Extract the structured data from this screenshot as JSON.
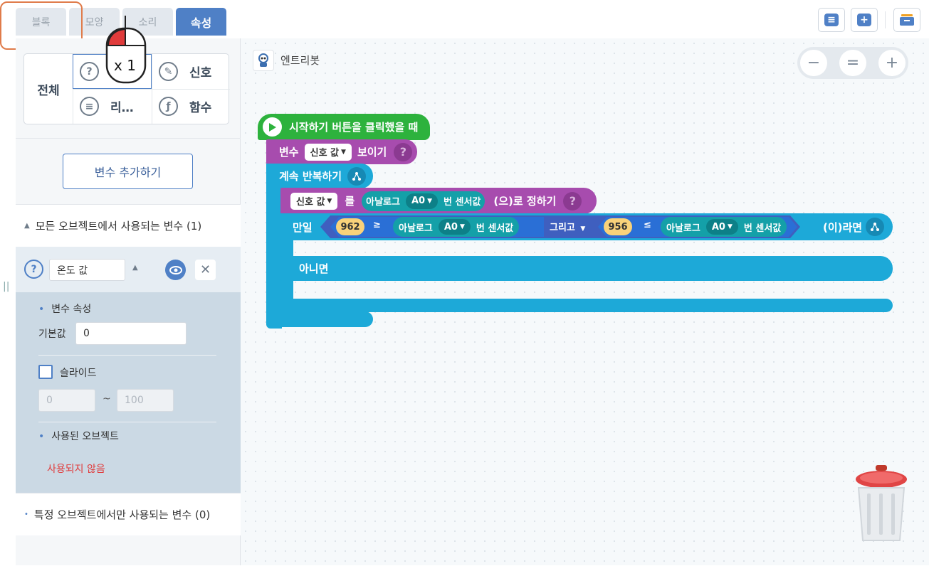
{
  "tabs": [
    {
      "label": "블록",
      "active": false
    },
    {
      "label": "모양",
      "active": false
    },
    {
      "label": "소리",
      "active": false
    },
    {
      "label": "속성",
      "active": true
    }
  ],
  "mouse_indicator": {
    "text": "x 1"
  },
  "categories": {
    "all_label": "전체",
    "items": [
      {
        "label": "",
        "icon": "question-icon"
      },
      {
        "label": "신호",
        "icon": "signal-icon"
      },
      {
        "label": "리…",
        "icon": "list-icon"
      },
      {
        "label": "함수",
        "icon": "function-icon"
      }
    ]
  },
  "add_variable_label": "변수 추가하기",
  "global_vars_header": "모든 오브젝트에서 사용되는 변수 (1)",
  "variable": {
    "name": "온도 값"
  },
  "var_props": {
    "title": "변수 속성",
    "default_label": "기본값",
    "default_value": "0",
    "slide_label": "슬라이드",
    "slide_min": "0",
    "slide_sep": "~",
    "slide_max": "100",
    "used_objects_title": "사용된 오브젝트",
    "not_used_text": "사용되지 않음"
  },
  "local_vars_header": "특정 오브젝트에서만 사용되는 변수 (0)",
  "object_name": "엔트리봇",
  "zoom": {
    "minus": "−",
    "reset": "=",
    "plus": "+"
  },
  "blocks": {
    "start": "시작하기 버튼을 클릭했을 때",
    "show_var_prefix": "변수",
    "show_var_name": "신호 값",
    "show_var_suffix": "보이기",
    "repeat": "계속 반복하기",
    "set_var_name": "신호 값",
    "set_var_particle": "를",
    "analog_label": "아날로그",
    "port": "A0",
    "sensor_suffix": "번 센서값",
    "set_suffix": "(으)로 정하기",
    "if_label": "만일",
    "val1": "962",
    "op1": "≥",
    "and_label": "그리고",
    "val2": "956",
    "op2": "≤",
    "then_label": "(이)라면",
    "else_label": "아니면",
    "help": "?"
  },
  "colors": {
    "accent": "#4f80c6",
    "event_green": "#2db23d",
    "variable_purple": "#a74cae",
    "flow_blue": "#1da9d8",
    "hardware_teal": "#14a0a8",
    "not_used_red": "#e03b3b"
  }
}
